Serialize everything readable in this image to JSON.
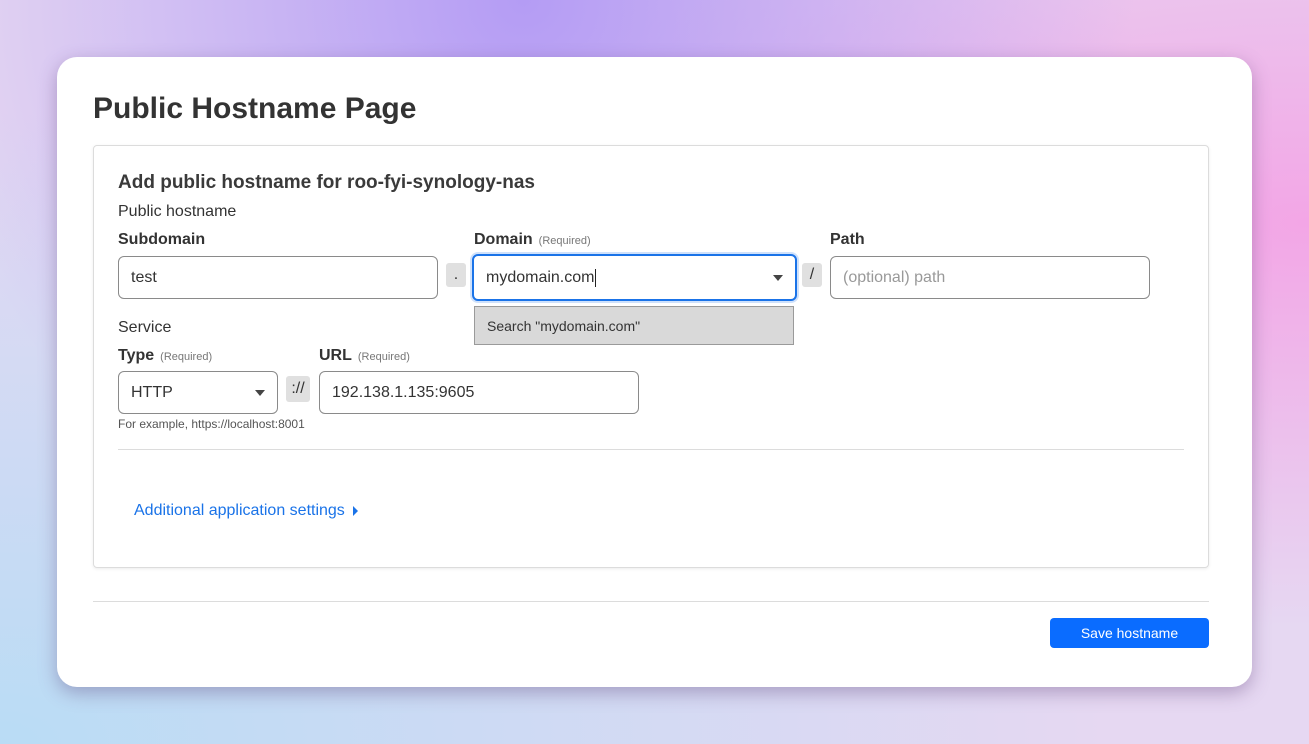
{
  "page_title": "Public Hostname Page",
  "form": {
    "heading": "Add public hostname for roo-fyi-synology-nas",
    "public_hostname_label": "Public hostname",
    "subdomain": {
      "label": "Subdomain",
      "value": "test"
    },
    "dot_separator": ".",
    "domain": {
      "label": "Domain",
      "required": "(Required)",
      "value": "mydomain.com",
      "dropdown_option": "Search \"mydomain.com\""
    },
    "slash_separator": "/",
    "path": {
      "label": "Path",
      "placeholder": "(optional) path"
    },
    "service_label": "Service",
    "type": {
      "label": "Type",
      "required": "(Required)",
      "value": "HTTP"
    },
    "scheme_separator": "://",
    "url": {
      "label": "URL",
      "required": "(Required)",
      "value": "192.138.1.135:9605",
      "hint": "For example, https://localhost:8001"
    },
    "additional_settings_link": "Additional application settings"
  },
  "save_button": "Save hostname",
  "colors": {
    "accent": "#0a6cff",
    "focus": "#1a73e8"
  }
}
